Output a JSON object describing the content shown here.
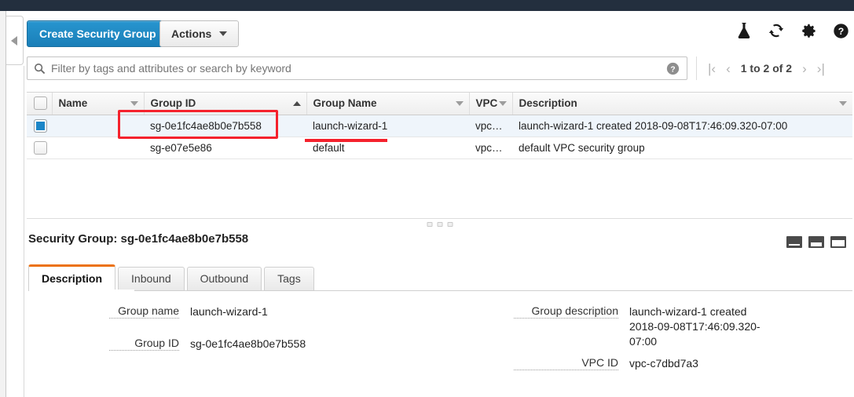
{
  "toolbar": {
    "create_label": "Create Security Group",
    "actions_label": "Actions",
    "icons": [
      {
        "name": "flask-icon",
        "title": "Experiments"
      },
      {
        "name": "refresh-icon",
        "title": "Refresh"
      },
      {
        "name": "gear-icon",
        "title": "Settings"
      },
      {
        "name": "help-icon",
        "title": "Help"
      }
    ]
  },
  "search": {
    "placeholder": "Filter by tags and attributes or search by keyword",
    "help_icon": "question-circle-icon"
  },
  "pagination": {
    "first": "|‹",
    "prev": "‹",
    "label": "1 to 2 of 2",
    "next": "›",
    "last": "›|"
  },
  "table": {
    "columns": [
      {
        "label": "Name",
        "sort": "desc"
      },
      {
        "label": "Group ID",
        "sort": "asc"
      },
      {
        "label": "Group Name",
        "sort": "desc"
      },
      {
        "label": "VPC",
        "sort": "desc"
      },
      {
        "label": "Description",
        "sort": "desc"
      }
    ],
    "rows": [
      {
        "selected": true,
        "checked": true,
        "name": "",
        "group_id": "sg-0e1fc4ae8b0e7b558",
        "group_name": "launch-wizard-1",
        "vpc": "vpc…",
        "description": "launch-wizard-1 created 2018-09-08T17:46:09.320-07:00"
      },
      {
        "selected": false,
        "checked": false,
        "name": "",
        "group_id": "sg-e07e5e86",
        "group_name": "default",
        "vpc": "vpc…",
        "description": "default VPC security group"
      }
    ]
  },
  "annotations": {
    "accent_color": "#f5222d",
    "box_target": "sg-0e1fc4ae8b0e7b558",
    "underline_target": "launch-wizard-1"
  },
  "detail": {
    "title": "Security Group: sg-0e1fc4ae8b0e7b558",
    "tabs": [
      {
        "label": "Description",
        "active": true
      },
      {
        "label": "Inbound",
        "active": false
      },
      {
        "label": "Outbound",
        "active": false
      },
      {
        "label": "Tags",
        "active": false
      }
    ],
    "layout_icons": [
      "panel-bottom-icon",
      "panel-split-icon",
      "panel-full-icon"
    ],
    "fields_left": [
      {
        "label": "Group name",
        "value": "launch-wizard-1"
      },
      {
        "label": "Group ID",
        "value": "sg-0e1fc4ae8b0e7b558"
      }
    ],
    "fields_right": [
      {
        "label": "Group description",
        "value": "launch-wizard-1 created 2018-09-08T17:46:09.320-07:00"
      },
      {
        "label": "VPC ID",
        "value": "vpc-c7dbd7a3"
      }
    ]
  },
  "theme": {
    "topnav_bg": "#232f3e",
    "primary_blue": "#1b86c8",
    "tab_accent": "#ec7211",
    "row_selected_bg": "#eff5fb"
  }
}
